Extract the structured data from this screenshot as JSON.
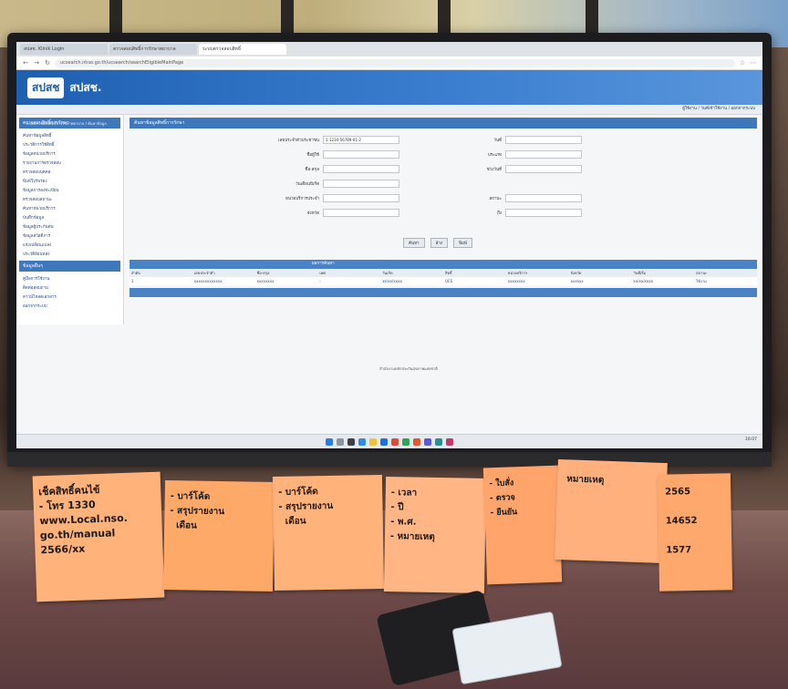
{
  "browser": {
    "tabs": [
      "สปสช. Klinik Login",
      "ตรวจสอบสิทธิ์การรักษาพยาบาล",
      "ระบบตรวจสอบสิทธิ์"
    ],
    "url": "ucsearch.nhso.go.th/ucsearch/searchEligibleMainPage"
  },
  "site": {
    "logo": "สปสช",
    "brand": "สปสช.",
    "subtitle": "ระบบตรวจสอบสิทธิ์การรักษาพยาบาล / ค้นหาข้อมูล",
    "infobar": "ผู้ใช้งาน / วันที่เข้าใช้งาน / ออกจากระบบ"
  },
  "sidebar": {
    "head1": "ตรวจสอบสิทธิ์การรักษา",
    "items1": [
      "ค้นหาข้อมูลสิทธิ์",
      "ประวัติการใช้สิทธิ์",
      "ข้อมูลหน่วยบริการ",
      "รายงานการตรวจสอบ",
      "ตรวจสอบบุคคล",
      "พิมพ์ใบรับรอง",
      "ข้อมูลการลงทะเบียน",
      "ตรวจสอบสถานะ",
      "ค้นหาหน่วยบริการ",
      "บันทึกข้อมูล",
      "ข้อมูลผู้ประกันตน",
      "ข้อมูลสวัสดิการ",
      "แจ้งเปลี่ยนแปลง",
      "ประวัติย้อนหลัง"
    ],
    "head2": "ข้อมูลอื่นๆ",
    "items2": [
      "คู่มือการใช้งาน",
      "ติดต่อสอบถาม",
      "ดาวน์โหลดเอกสาร",
      "ออกจากระบบ"
    ]
  },
  "main": {
    "panel_title": "ค้นหาข้อมูลสิทธิ์การรักษา",
    "fields_left": [
      "เลขประจำตัวประชาชน",
      "ชื่อผู้ใช้",
      "ชื่อ-สกุล",
      "วันเดือนปีเกิด",
      "หน่วยบริการประจำ",
      "จังหวัด"
    ],
    "fields_right": [
      "วันที่",
      "ประเภท",
      "ช่วงวันที่",
      "สถานะ",
      "ถึง"
    ],
    "id_value": "1-1234-56789-01-2",
    "buttons": [
      "ค้นหา",
      "ล้าง",
      "พิมพ์"
    ],
    "grid_title": "ผลการค้นหา",
    "grid_headers": [
      "ลำดับ",
      "เลขประจำตัว",
      "ชื่อ-สกุล",
      "เพศ",
      "วันเกิด",
      "สิทธิ์",
      "หน่วยบริการ",
      "จังหวัด",
      "วันที่เริ่ม",
      "สถานะ"
    ],
    "grid_row": [
      "1",
      "xxxxxxxxxxxxx",
      "xxxxxxxx",
      "-",
      "xx/xx/xxxx",
      "UCS",
      "xxxxxxxx",
      "xxxxxx",
      "xx/xx/xxxx",
      "ใช้งาน"
    ],
    "footer": "สำนักงานหลักประกันสุขภาพแห่งชาติ"
  },
  "taskbar": {
    "clock": "16:07"
  },
  "notes": [
    {
      "text": "เช็คสิทธิ์คนไข้\n- โทร 1330\nwww.Local.nso.\ngo.th/manual\n2566/xx"
    },
    {
      "text": "- บาร์โค้ด\n- สรุปรายงาน\n  เดือน"
    },
    {
      "text": "- เวลา\n- ปี\n- พ.ศ.\n- หมายเหตุ"
    },
    {
      "text": "- ใบสั่ง\n- ตรวจ\n- ยืนยัน"
    },
    {
      "text": "หมายเหตุ"
    },
    {
      "text": "2565\n\n14652\n\n1577"
    }
  ],
  "colors": {
    "header": "#1e5fb0",
    "note": "#ffb27a"
  }
}
